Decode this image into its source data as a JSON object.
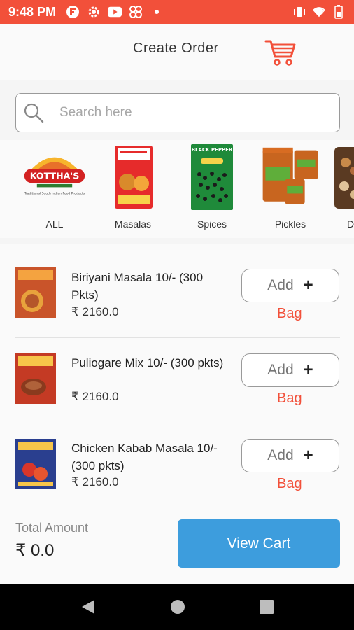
{
  "status_bar": {
    "time": "9:48 PM",
    "icons": [
      "flipboard-icon",
      "settings-icon",
      "youtube-icon",
      "fan-icon",
      "dot-icon",
      "vibrate-icon",
      "wifi-icon",
      "battery-icon"
    ]
  },
  "header": {
    "title": "Create Order",
    "cart_icon": "cart-icon"
  },
  "search": {
    "placeholder": "Search here"
  },
  "categories": [
    {
      "label": "ALL",
      "thumb": "kotthas-logo",
      "logo_text": "KOTTHA'S",
      "logo_sub": "Traditional South Indian Food Products"
    },
    {
      "label": "Masalas",
      "thumb": "masala-pack"
    },
    {
      "label": "Spices",
      "thumb": "black-pepper-pack",
      "pack_text": "BLACK PEPPER"
    },
    {
      "label": "Pickles",
      "thumb": "pickle-jars"
    },
    {
      "label": "D",
      "thumb": "dry-fruits-box"
    }
  ],
  "products": [
    {
      "name": "Biriyani Masala 10/- (300 Pkts)",
      "price": "₹ 2160.0",
      "add_label": "Add",
      "plus": "+",
      "bag_label": "Bag"
    },
    {
      "name": "Puliogare Mix 10/- (300 pkts)",
      "price": "₹ 2160.0",
      "add_label": "Add",
      "plus": "+",
      "bag_label": "Bag"
    },
    {
      "name": "Chicken Kabab Masala 10/- (300 pkts)",
      "price": "₹ 2160.0",
      "add_label": "Add",
      "plus": "+",
      "bag_label": "Bag"
    }
  ],
  "footer": {
    "total_label": "Total Amount",
    "total_value": "₹ 0.0",
    "view_cart_label": "View Cart"
  },
  "colors": {
    "accent": "#f2503a",
    "button_blue": "#3d9ddd"
  }
}
